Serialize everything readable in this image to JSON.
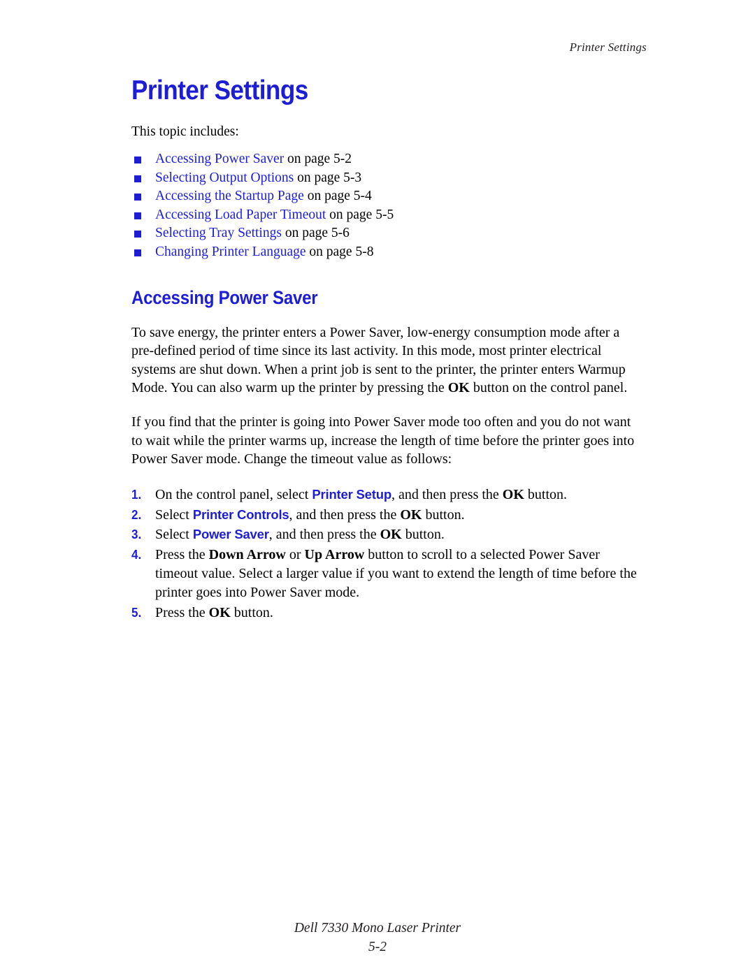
{
  "header": {
    "running_title": "Printer Settings"
  },
  "title": "Printer Settings",
  "intro": "This topic includes:",
  "topics": [
    {
      "link": "Accessing Power Saver",
      "tail": " on page 5-2"
    },
    {
      "link": "Selecting Output Options",
      "tail": " on page 5-3"
    },
    {
      "link": "Accessing the Startup Page",
      "tail": " on page 5-4"
    },
    {
      "link": "Accessing Load Paper Timeout",
      "tail": " on page 5-5"
    },
    {
      "link": "Selecting Tray Settings",
      "tail": " on page 5-6"
    },
    {
      "link": "Changing Printer Language",
      "tail": " on page 5-8"
    }
  ],
  "section": {
    "heading": "Accessing Power Saver",
    "paragraph_1": {
      "part_a": "To save energy, the printer enters a Power Saver, low-energy consumption mode after a pre-defined period of time since its last activity. In this mode, most printer electrical systems are shut down. When a print job is sent to the printer, the printer enters Warmup Mode. You can also warm up the printer by pressing the ",
      "bold_ok": "OK",
      "part_b": " button on the control panel."
    },
    "paragraph_2": "If you find that the printer is going into Power Saver mode too often and you do not want to wait while the printer warms up, increase the length of time before the printer goes into Power Saver mode. Change the timeout value as follows:"
  },
  "steps": [
    {
      "number": "1.",
      "text_a": "On the control panel, select ",
      "ui_term": "Printer Setup",
      "text_b": ", and then press the ",
      "bold_ok": "OK",
      "text_c": " button."
    },
    {
      "number": "2.",
      "text_a": "Select ",
      "ui_term": "Printer Controls",
      "text_b": ", and then press the ",
      "bold_ok": "OK",
      "text_c": " button."
    },
    {
      "number": "3.",
      "text_a": "Select ",
      "ui_term": "Power Saver",
      "text_b": ", and then press the ",
      "bold_ok": "OK",
      "text_c": " button."
    },
    {
      "number": "4.",
      "text_a": "Press the ",
      "bold_down": "Down Arrow",
      "text_b": " or ",
      "bold_up": "Up Arrow",
      "text_c": " button to scroll to a selected Power Saver timeout value. Select a larger value if you want to extend the length of time before the printer goes into Power Saver mode."
    },
    {
      "number": "5.",
      "text_a": "Press the ",
      "bold_ok": "OK",
      "text_c": " button."
    }
  ],
  "footer": {
    "product": "Dell 7330 Mono Laser Printer",
    "page_number": "5-2"
  },
  "colors": {
    "accent_blue": "#1d1dd6",
    "body_text": "#000000",
    "header_text": "#231f20",
    "background": "#ffffff"
  }
}
